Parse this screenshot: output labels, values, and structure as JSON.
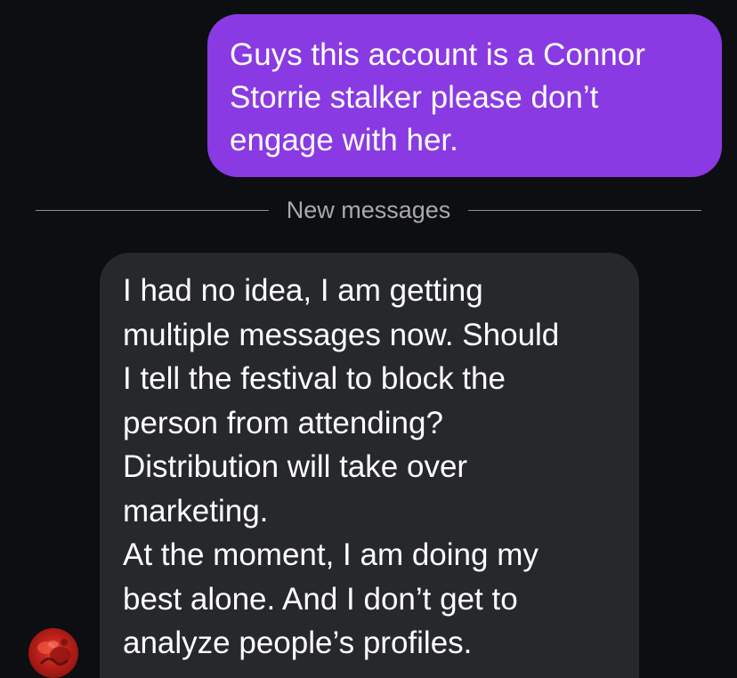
{
  "outgoing_message": {
    "text": "Guys this account is a Connor\nStorrie stalker please don’t\nengage with her."
  },
  "divider": {
    "label": "New messages"
  },
  "incoming_message": {
    "lines": [
      "I had no idea, I am getting",
      "multiple messages now. Should",
      "I tell the festival to block the",
      "person from attending?",
      "Distribution will take over",
      "marketing.",
      "At the moment, I am doing my",
      "best alone. And I don’t get to",
      "analyze people’s profiles."
    ]
  },
  "colors": {
    "background": "#0c0e12",
    "outgoing_bubble": "#8a3ae3",
    "incoming_bubble": "#26282c",
    "divider_text": "#a9a9ae"
  },
  "icons": {
    "avatar": "sender-avatar"
  }
}
